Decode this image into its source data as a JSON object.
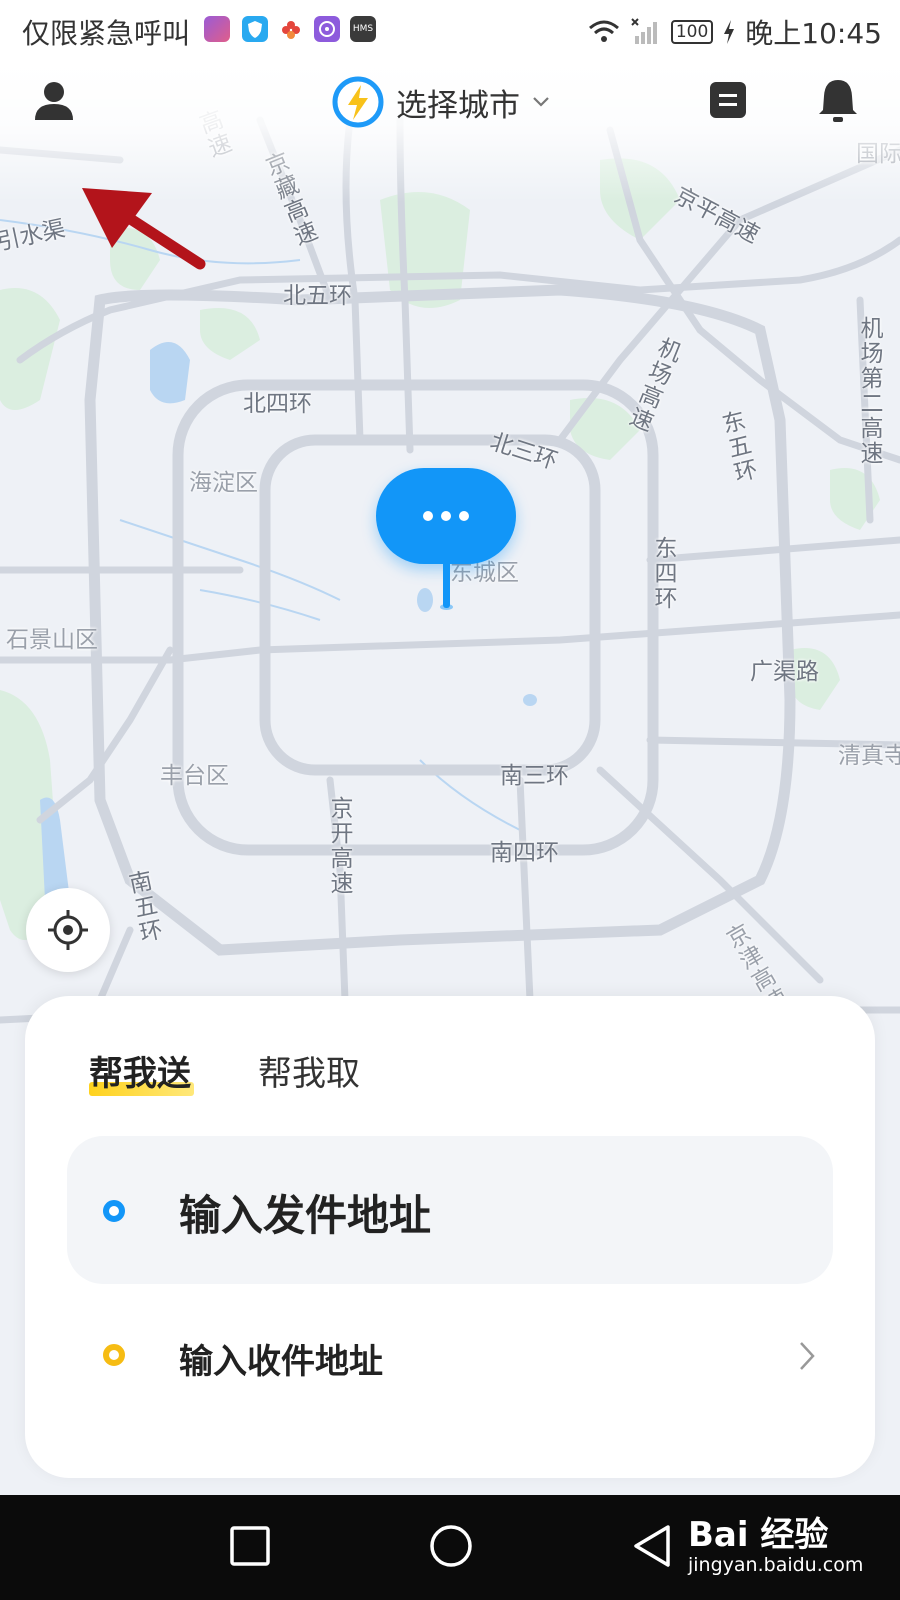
{
  "status_bar": {
    "carrier": "仅限紧急呼叫",
    "battery": "100",
    "time": "晚上10:45",
    "app_icons": [
      "game-app-icon",
      "shield-app-icon",
      "flower-app-icon",
      "music-app-icon",
      "hms-app-icon"
    ],
    "hms_label": "HMS"
  },
  "header": {
    "city_label": "选择城市",
    "icons": [
      "profile-icon",
      "lightning-logo-icon",
      "chevron-down-icon",
      "orders-icon",
      "bell-icon"
    ]
  },
  "map": {
    "labels": {
      "beiwuhuan": "北五环",
      "beisihuan": "北四环",
      "beisanhuan": "北三环",
      "haidian": "海淀区",
      "dongcheng": "东城区",
      "shijingshan": "石景山区",
      "fengtai": "丰台区",
      "nansanhuan": "南三环",
      "nansihuan": "南四环",
      "nanwuhuan": "南五环",
      "guangqulu": "广渠路",
      "qingzhen": "清真寺",
      "jingzang": "京藏高速",
      "jingping": "京平高速",
      "jichang": "机场高速",
      "jichang2": "机场第二高速",
      "dongwuhuan": "东五环",
      "dongsihuan": "东四环",
      "jingkai": "京开高速",
      "jinghu": "京津高速",
      "yinshuiqu": "引水渠",
      "gaosu": "高速",
      "guoji": "国际"
    },
    "pin_label": "..."
  },
  "card": {
    "tabs": [
      {
        "label": "帮我送",
        "active": true
      },
      {
        "label": "帮我取",
        "active": false
      }
    ],
    "sender_placeholder": "输入发件地址",
    "receiver_placeholder": "输入收件地址",
    "colors": {
      "accent": "#1296f8",
      "receiver": "#f6bc13",
      "tab_underline": "#ffd21e"
    }
  },
  "nav_bar": {
    "buttons": [
      "recent-apps-button",
      "home-button",
      "back-button"
    ],
    "watermark_brand": "Bai 经验",
    "watermark_url": "jingyan.baidu.com"
  }
}
